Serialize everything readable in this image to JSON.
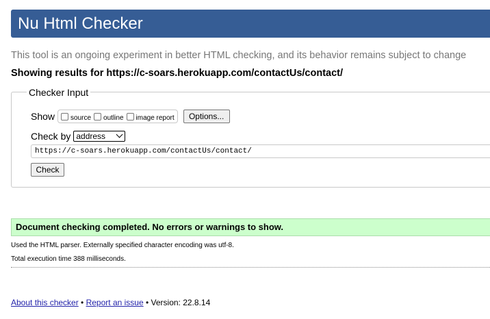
{
  "header": {
    "title": "Nu Html Checker",
    "bg_color": "#365d95"
  },
  "intro": {
    "text": "This tool is an ongoing experiment in better HTML checking, and its behavior remains subject to change",
    "showing": "Showing results for https://c-soars.herokuapp.com/contactUs/contact/"
  },
  "checker_input": {
    "legend": "Checker Input",
    "show_label": "Show",
    "options": [
      {
        "label": "source",
        "checked": false
      },
      {
        "label": "outline",
        "checked": false
      },
      {
        "label": "image report",
        "checked": false
      }
    ],
    "options_button": "Options...",
    "check_by_label": "Check by",
    "check_by_value": "address",
    "url_value": "https://c-soars.herokuapp.com/contactUs/contact/",
    "check_button": "Check"
  },
  "results": {
    "success_message": "Document checking completed. No errors or warnings to show.",
    "success_color": "#ccffcc",
    "parser_info": "Used the HTML parser. Externally specified character encoding was utf-8.",
    "exec_time": "Total execution time 388 milliseconds."
  },
  "footer": {
    "about_link": "About this checker",
    "sep1": " • ",
    "report_link": "Report an issue",
    "version": " • Version: 22.8.14",
    "link_color": "#2222aa"
  }
}
